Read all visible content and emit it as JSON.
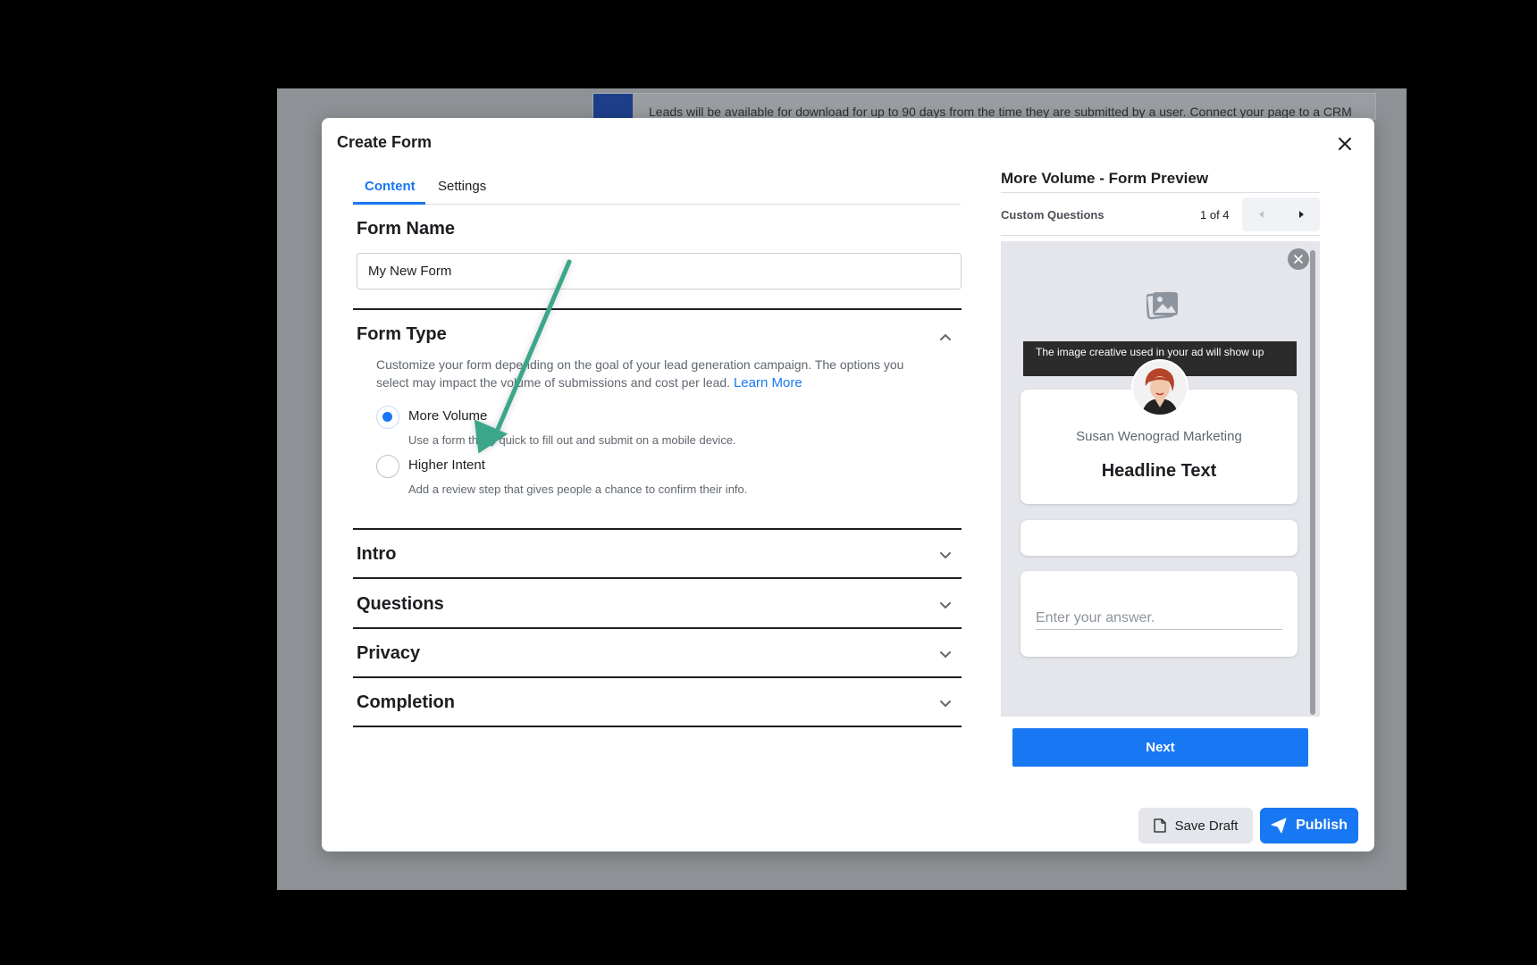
{
  "background": {
    "banner_text": "Leads will be available for download for up to 90 days from the time they are submitted by a user. Connect your page to a CRM"
  },
  "modal": {
    "title": "Create Form"
  },
  "tabs": [
    {
      "label": "Content",
      "active": true
    },
    {
      "label": "Settings",
      "active": false
    }
  ],
  "form_name": {
    "heading": "Form Name",
    "value": "My New Form"
  },
  "form_type": {
    "heading": "Form Type",
    "description": "Customize your form depending on the goal of your lead generation campaign. The options you select may impact the volume of submissions and cost per lead.",
    "learn_more": "Learn More",
    "options": [
      {
        "label": "More Volume",
        "sub": "Use a form that's quick to fill out and submit on a mobile device.",
        "selected": true
      },
      {
        "label": "Higher Intent",
        "sub": "Add a review step that gives people a chance to confirm their info.",
        "selected": false
      }
    ]
  },
  "sections": [
    {
      "label": "Intro"
    },
    {
      "label": "Questions"
    },
    {
      "label": "Privacy"
    },
    {
      "label": "Completion"
    }
  ],
  "preview": {
    "title": "More Volume - Form Preview",
    "subtitle": "Custom Questions",
    "page_indicator": "1 of 4",
    "tooltip": "The image creative used in your ad will show up",
    "company": "Susan Wenograd Marketing",
    "headline": "Headline Text",
    "answer_placeholder": "Enter your answer.",
    "next_label": "Next"
  },
  "footer": {
    "save_draft": "Save Draft",
    "publish": "Publish"
  },
  "colors": {
    "accent": "#1877f2",
    "annotation_arrow": "#3aa68a"
  },
  "icons": [
    "close-icon",
    "chevron-up-icon",
    "chevron-down-icon",
    "image-icon",
    "document-icon",
    "send-icon",
    "caret-left-icon",
    "caret-right-icon"
  ]
}
